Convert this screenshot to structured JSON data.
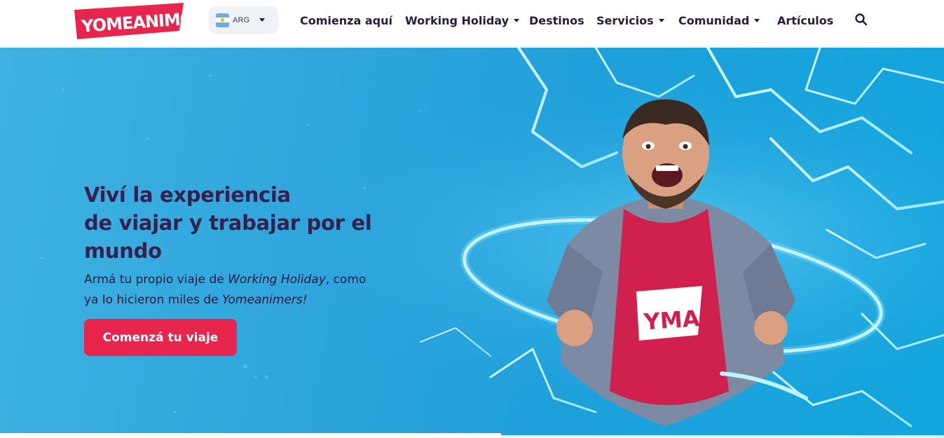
{
  "brand": {
    "logo_text": "YOMEANIMO!",
    "colors": {
      "primary": "#e8264d",
      "navy": "#2b1a3d",
      "sky": "#1fa0da"
    }
  },
  "header": {
    "country_selector": {
      "flag_icon": "argentina-flag-icon",
      "code": "ARG"
    },
    "nav": [
      {
        "label": "Comienza aquí",
        "dropdown": false
      },
      {
        "label": "Working Holiday",
        "dropdown": true
      },
      {
        "label": "Destinos",
        "dropdown": false
      },
      {
        "label": "Servicios",
        "dropdown": true
      },
      {
        "label": "Comunidad",
        "dropdown": true
      },
      {
        "label": "Artículos",
        "dropdown": false
      }
    ],
    "search_icon": "search-icon"
  },
  "hero": {
    "headline_lines": [
      "Viví la experiencia",
      "de viajar y trabajar por el",
      "mundo"
    ],
    "subtext": {
      "part1": "Armá tu propio viaje de ",
      "italic1": "Working Holiday",
      "part2": ", como",
      "part3": "ya lo hicieron miles de ",
      "italic2": "Yomeanimers!"
    },
    "cta_label": "Comenzá tu viaje",
    "shirt_text": "YMA!"
  }
}
